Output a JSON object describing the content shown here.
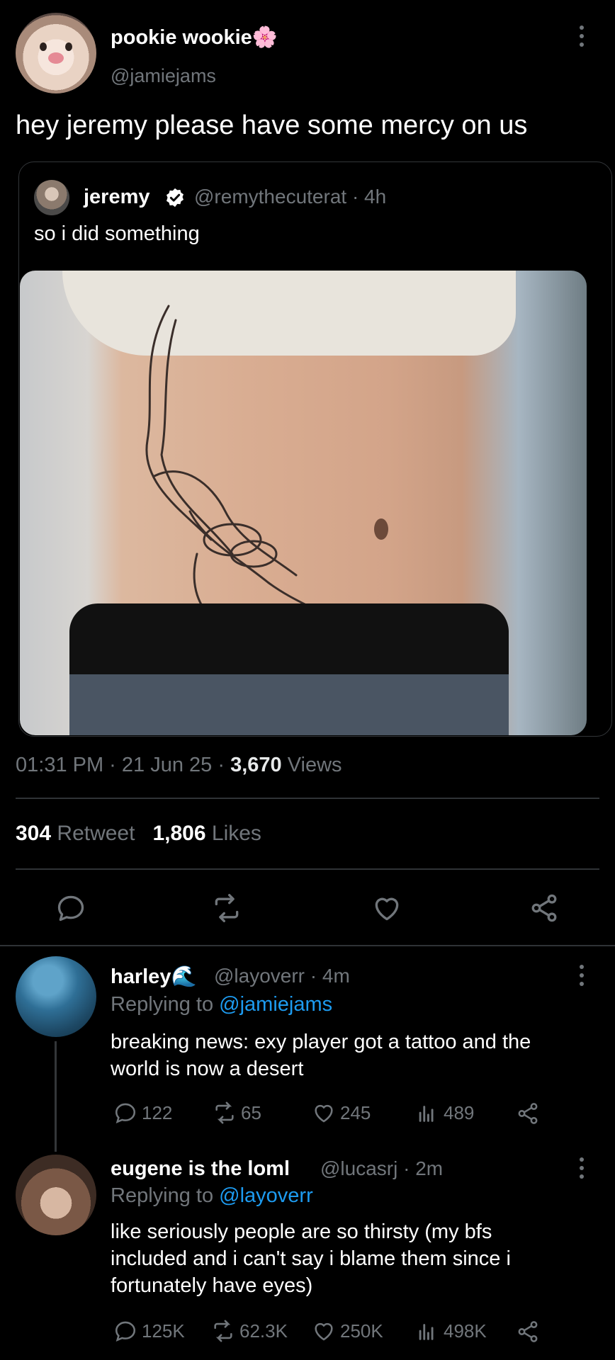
{
  "main_tweet": {
    "display_name": "pookie wookie🌸",
    "handle": "@jamiejams",
    "text": "hey jeremy please have some mercy on us",
    "timestamp": "01:31 PM · 21 Jun 25 · ",
    "views_count": "3,670",
    "views_label": " Views",
    "retweets_count": "304",
    "retweets_label": " Retweet",
    "likes_count": "1,806",
    "likes_label": " Likes"
  },
  "quote": {
    "name": "jeremy",
    "meta": "@remythecuterat · 4h",
    "text": "so i did something"
  },
  "actions": [
    "reply-icon",
    "retweet-icon",
    "like-icon",
    "share-icon"
  ],
  "replies": [
    {
      "name": "harley🌊",
      "meta": "@layoverr · 4m",
      "replying_prefix": "Replying to ",
      "replying_to": "@jamiejams",
      "text_line1": "breaking news: exy player got a tattoo and the",
      "text_line2": "world is now a desert",
      "replies": "122",
      "retweets": "65",
      "likes": "245",
      "views": "489"
    },
    {
      "name": "eugene is the loml",
      "meta": "@lucasrj · 2m",
      "replying_prefix": "Replying to ",
      "replying_to": "@layoverr",
      "text_line1": "like seriously people are so thirsty (my bfs",
      "text_line2": "included and i can't say i blame them since i",
      "text_line3": "fortunately have eyes)",
      "replies": "125K",
      "retweets": "62.3K",
      "likes": "250K",
      "views": "498K"
    }
  ],
  "colors": {
    "background": "#000000",
    "text": "#e7e9ea",
    "muted": "#71767b",
    "link": "#1d9bf0"
  }
}
